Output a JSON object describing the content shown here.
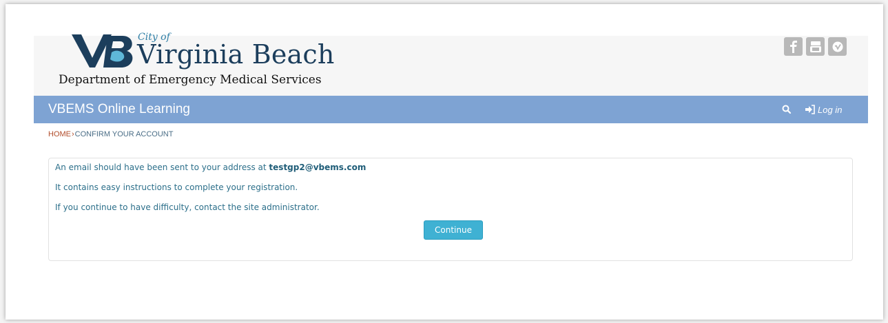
{
  "header": {
    "logo_text": "VB",
    "city_of": "City of",
    "brand_name": "Virginia Beach",
    "department": "Department of Emergency Medical Services",
    "social_icons": [
      "facebook-icon",
      "youtube-icon",
      "vimeo-icon"
    ]
  },
  "navbar": {
    "site_title": "VBEMS Online Learning",
    "search_icon": "search-icon",
    "login_icon": "sign-in-icon",
    "login_label": "Log in"
  },
  "breadcrumb": {
    "home": "HOME",
    "separator": "›",
    "current": "CONFIRM YOUR ACCOUNT"
  },
  "confirmation": {
    "line1_prefix": "An email should have been sent to your address at ",
    "email": "testgp2@vbems.com",
    "line2": "It contains easy instructions to complete your registration.",
    "line3": "If you continue to have difficulty, contact the site administrator.",
    "continue_label": "Continue"
  },
  "colors": {
    "navbar": "#7ea3d3",
    "button": "#3fb1d3",
    "brand_dark": "#1c3e5c",
    "breadcrumb_home": "#b14d2b",
    "message_text": "#2c6f8a"
  }
}
